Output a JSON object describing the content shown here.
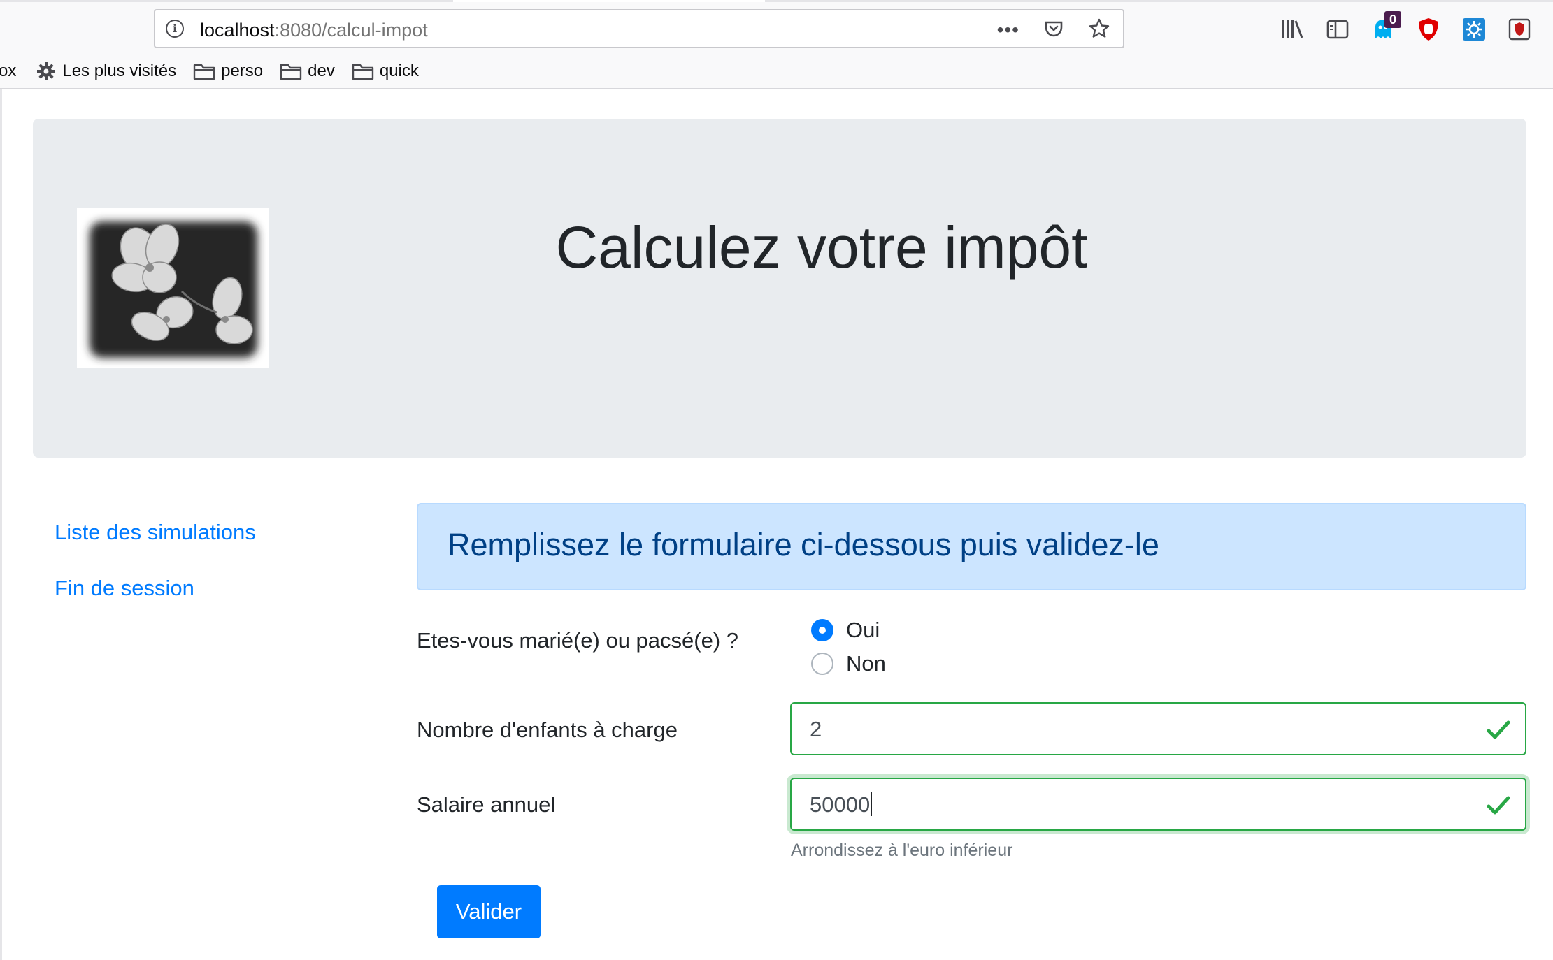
{
  "browser": {
    "url_host": "localhost",
    "url_rest": ":8080/calcul-impot",
    "overflow_dots": "•••",
    "notification_count": "0",
    "bookmarks": [
      {
        "label": "ox",
        "icon": "none"
      },
      {
        "label": "Les plus visités",
        "icon": "gear-icon"
      },
      {
        "label": "perso",
        "icon": "folder-icon"
      },
      {
        "label": "dev",
        "icon": "folder-icon"
      },
      {
        "label": "quick",
        "icon": "folder-icon"
      }
    ]
  },
  "header": {
    "title": "Calculez votre impôt",
    "logo": "flower-photo"
  },
  "sidebar": {
    "links": [
      "Liste des simulations",
      "Fin de session"
    ]
  },
  "form": {
    "alert": "Remplissez le formulaire ci-dessous puis validez-le",
    "married_label": "Etes-vous marié(e) ou pacsé(e) ?",
    "married_options": [
      "Oui",
      "Non"
    ],
    "married_selected": "Oui",
    "children_label": "Nombre d'enfants à charge",
    "children_value": "2",
    "salary_label": "Salaire annuel",
    "salary_value": "50000",
    "salary_help": "Arrondissez à l'euro inférieur",
    "submit_label": "Valider"
  },
  "colors": {
    "link": "#007bff",
    "valid": "#28a745",
    "alert_bg": "#cce5ff",
    "alert_text": "#004085",
    "jumbotron_bg": "#e9ecef"
  }
}
